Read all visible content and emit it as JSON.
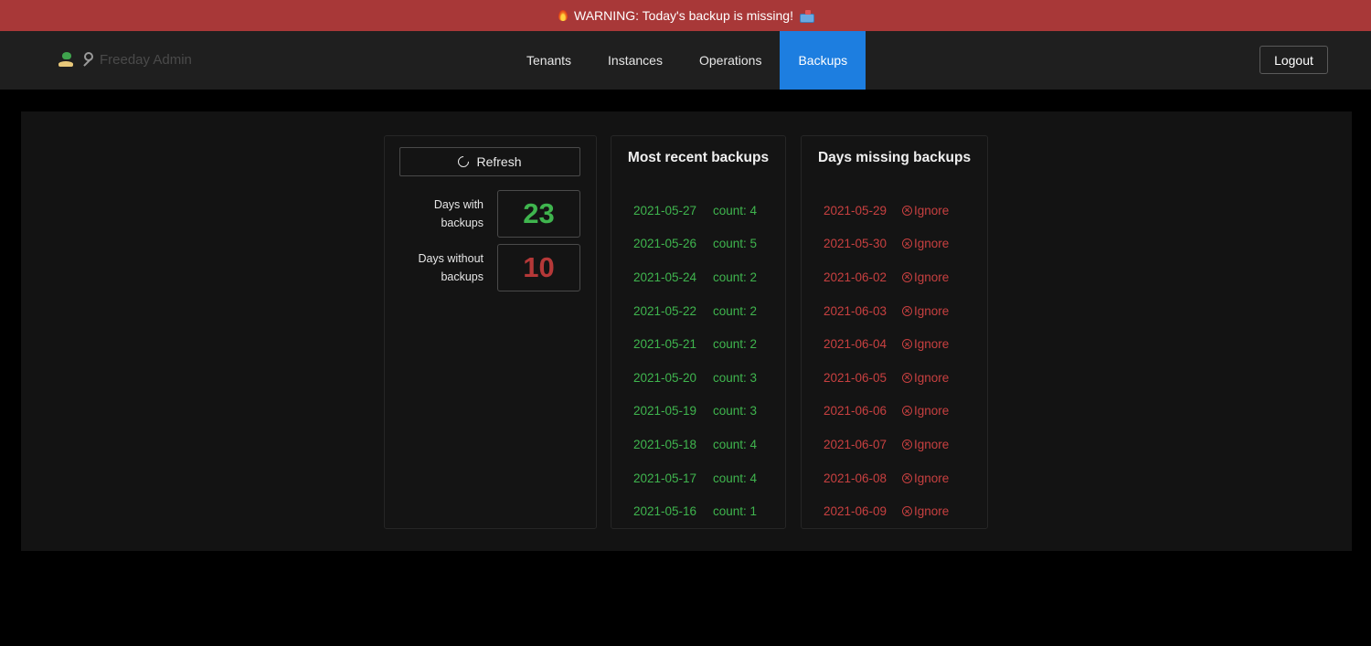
{
  "banner": {
    "text": "WARNING: Today's backup is missing!",
    "leading_icon": "fire-icon",
    "trailing_icon": "package-icon",
    "background_color": "#a83838"
  },
  "navbar": {
    "brand": "Freeday Admin",
    "brand_icons": [
      "island-icon",
      "key-icon"
    ],
    "links": [
      {
        "label": "Tenants",
        "active": false
      },
      {
        "label": "Instances",
        "active": false
      },
      {
        "label": "Operations",
        "active": false
      },
      {
        "label": "Backups",
        "active": true
      }
    ],
    "logout_label": "Logout",
    "active_color": "#1d7ee0"
  },
  "stats": {
    "refresh_label": "Refresh",
    "refresh_icon": "refresh-icon",
    "with_backups_label": "Days with backups",
    "with_backups_value": "23",
    "without_backups_label": "Days without backups",
    "without_backups_value": "10",
    "success_color": "#3fb54e",
    "danger_color": "#b53838"
  },
  "recent": {
    "title": "Most recent backups",
    "items": [
      {
        "date": "2021-05-27",
        "count": "count: 4"
      },
      {
        "date": "2021-05-26",
        "count": "count: 5"
      },
      {
        "date": "2021-05-24",
        "count": "count: 2"
      },
      {
        "date": "2021-05-22",
        "count": "count: 2"
      },
      {
        "date": "2021-05-21",
        "count": "count: 2"
      },
      {
        "date": "2021-05-20",
        "count": "count: 3"
      },
      {
        "date": "2021-05-19",
        "count": "count: 3"
      },
      {
        "date": "2021-05-18",
        "count": "count: 4"
      },
      {
        "date": "2021-05-17",
        "count": "count: 4"
      },
      {
        "date": "2021-05-16",
        "count": "count: 1"
      }
    ]
  },
  "missing": {
    "title": "Days missing backups",
    "ignore_label": "Ignore",
    "ignore_icon": "x-circle-icon",
    "items": [
      {
        "date": "2021-05-29"
      },
      {
        "date": "2021-05-30"
      },
      {
        "date": "2021-06-02"
      },
      {
        "date": "2021-06-03"
      },
      {
        "date": "2021-06-04"
      },
      {
        "date": "2021-06-05"
      },
      {
        "date": "2021-06-06"
      },
      {
        "date": "2021-06-07"
      },
      {
        "date": "2021-06-08"
      },
      {
        "date": "2021-06-09"
      }
    ]
  }
}
